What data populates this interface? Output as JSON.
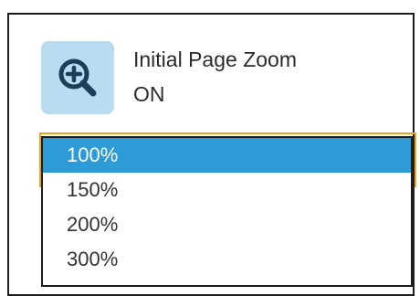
{
  "setting": {
    "title": "Initial Page Zoom",
    "value": "ON",
    "icon": "zoom-in-icon"
  },
  "dropdown": {
    "selected_index": 0,
    "options": [
      "100%",
      "150%",
      "200%",
      "300%"
    ]
  },
  "colors": {
    "icon_tile": "#b9dcf1",
    "icon_glyph": "#1b3f59",
    "selected_bg": "#2d9bd6",
    "focus_border": "#f0a21a"
  }
}
